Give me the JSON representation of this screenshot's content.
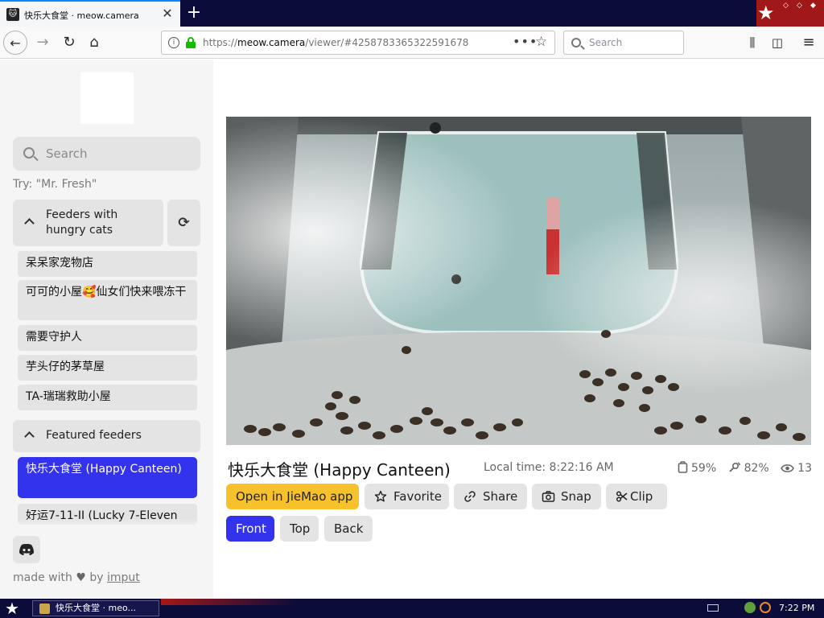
{
  "browser": {
    "tab_title": "快乐大食堂 · meow.camera",
    "new_tab_glyph": "+",
    "close_glyph": "✕",
    "url_scheme": "https://",
    "url_host": "meow.camera",
    "url_path": "/viewer/#4258783365322591678",
    "search_placeholder": "Search",
    "page_actions_glyph": "•••"
  },
  "sidebar": {
    "search_placeholder": "Search",
    "try_hint": "Try: \"Mr. Fresh\"",
    "hungry_group_label": "Feeders with hungry cats",
    "hungry_feeders": [
      "呆呆家宠物店",
      "可可的小屋🥰仙女们快来喂冻干",
      "需要守护人",
      "芋头仔的茅草屋",
      "TA-瑞瑞救助小屋"
    ],
    "featured_group_label": "Featured feeders",
    "featured_feeders": [
      "快乐大食堂 (Happy Canteen)",
      "好运7-11-II (Lucky 7-Eleven"
    ],
    "made_with_prefix": "made with",
    "made_with_by": "by",
    "made_with_author": "imput"
  },
  "main": {
    "camera_title": "快乐大食堂 (Happy Canteen)",
    "local_time": "Local time: 8:22:16 AM",
    "stats": {
      "food_level": "59%",
      "signal": "82%",
      "viewers": "13"
    },
    "actions": {
      "open_app": "Open in JieMao app",
      "favorite": "Favorite",
      "share": "Share",
      "snap": "Snap",
      "clip": "Clip"
    },
    "views": {
      "front": "Front",
      "top": "Top",
      "back": "Back",
      "selected": "front"
    }
  },
  "taskbar": {
    "window_title": "快乐大食堂 · meo...",
    "clock": "7:22 PM"
  },
  "colors": {
    "accent_blue": "#3333ee",
    "app_button_yellow": "#f6c12a",
    "lock_green": "#12bc00",
    "taskbar_navy": "#0c0c3a"
  }
}
